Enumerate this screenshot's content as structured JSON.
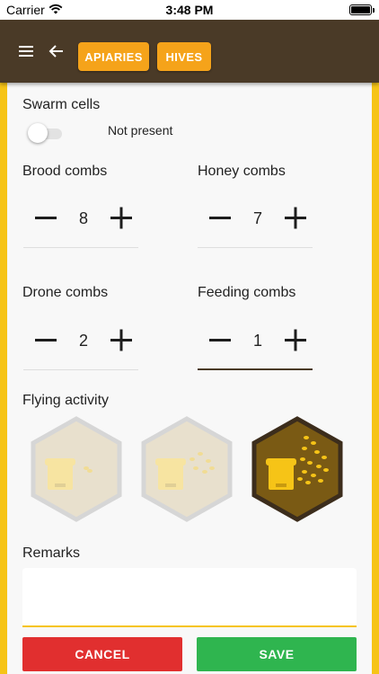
{
  "status_bar": {
    "carrier": "Carrier",
    "time": "3:48 PM"
  },
  "app_bar": {
    "tabs": [
      {
        "label": "APIARIES"
      },
      {
        "label": "HIVES"
      }
    ]
  },
  "swarm_cells": {
    "label": "Swarm cells",
    "toggle_text": "Not present",
    "enabled": false
  },
  "combs": {
    "brood": {
      "label": "Brood combs",
      "value": "8"
    },
    "honey": {
      "label": "Honey combs",
      "value": "7"
    },
    "drone": {
      "label": "Drone combs",
      "value": "2"
    },
    "feeding": {
      "label": "Feeding combs",
      "value": "1"
    }
  },
  "flying_activity": {
    "label": "Flying activity",
    "options": [
      "low",
      "medium",
      "high"
    ],
    "selected": "high"
  },
  "remarks": {
    "label": "Remarks",
    "value": ""
  },
  "actions": {
    "cancel": "CANCEL",
    "save": "SAVE"
  },
  "colors": {
    "primary": "#4a3a27",
    "accent": "#f6c417",
    "tab": "#f5a31a",
    "cancel": "#e12f2f",
    "save": "#2fb54f"
  }
}
